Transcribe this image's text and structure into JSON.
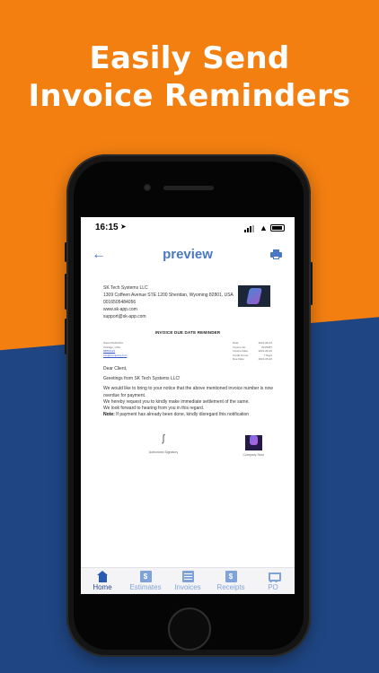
{
  "headline": {
    "line1": "Easily Send",
    "line2": "Invoice Reminders"
  },
  "status_bar": {
    "time": "16:15",
    "location_icon": "location-arrow-icon"
  },
  "nav": {
    "title": "preview",
    "back_icon": "back-arrow-icon",
    "print_icon": "printer-icon"
  },
  "document": {
    "company": {
      "name": "SK Tech Systems LLC",
      "address": "1309 Coffeen Avenue STE 1200 Sheridan, Wyoming 82801, USA",
      "phone": "0016505484056",
      "website": "www.sk-app.com",
      "email": "support@sk-app.com"
    },
    "title": "INVOICE DUE DATE REMINDER",
    "recipient": {
      "line1": "Steve Rodinicha",
      "line2": "Chicago, USA",
      "link1": "98861122",
      "link2": "info@company.com"
    },
    "meta": [
      {
        "label": "Date:",
        "value": "2021-06-22"
      },
      {
        "label": "Invoice No:",
        "value": "INV0287"
      },
      {
        "label": "Invoice Date:",
        "value": "2021-06-22"
      },
      {
        "label": "Credit Terms:",
        "value": "7 Days"
      },
      {
        "label": "Due Date:",
        "value": "2021-06-22"
      }
    ],
    "greeting": "Dear Client,",
    "intro": "Greetings from SK Tech Systems LLC!",
    "para1": "We would like to bring to your notice that the above mentioned invoice number is now overdue for payment.",
    "para2": "We hereby request you to kindly make immediate settlement of the same.",
    "para3": "We look forward to hearing from you in this regard.",
    "note_label": "Note:",
    "note_text": " If payment has already been done, kindly disregard this notification",
    "signatory_label": "Authorized Signatory",
    "seal_label": "Company Seal"
  },
  "tabs": [
    {
      "label": "Home",
      "icon": "home-icon",
      "active": true
    },
    {
      "label": "Estimates",
      "icon": "estimates-icon",
      "active": false
    },
    {
      "label": "Invoices",
      "icon": "invoices-icon",
      "active": false
    },
    {
      "label": "Receipts",
      "icon": "receipts-icon",
      "active": false
    },
    {
      "label": "PO",
      "icon": "cart-icon",
      "active": false
    }
  ],
  "colors": {
    "orange": "#f37f11",
    "navy": "#1f4683",
    "accent": "#4a78c4",
    "tab_inactive": "#7fa3d8"
  }
}
